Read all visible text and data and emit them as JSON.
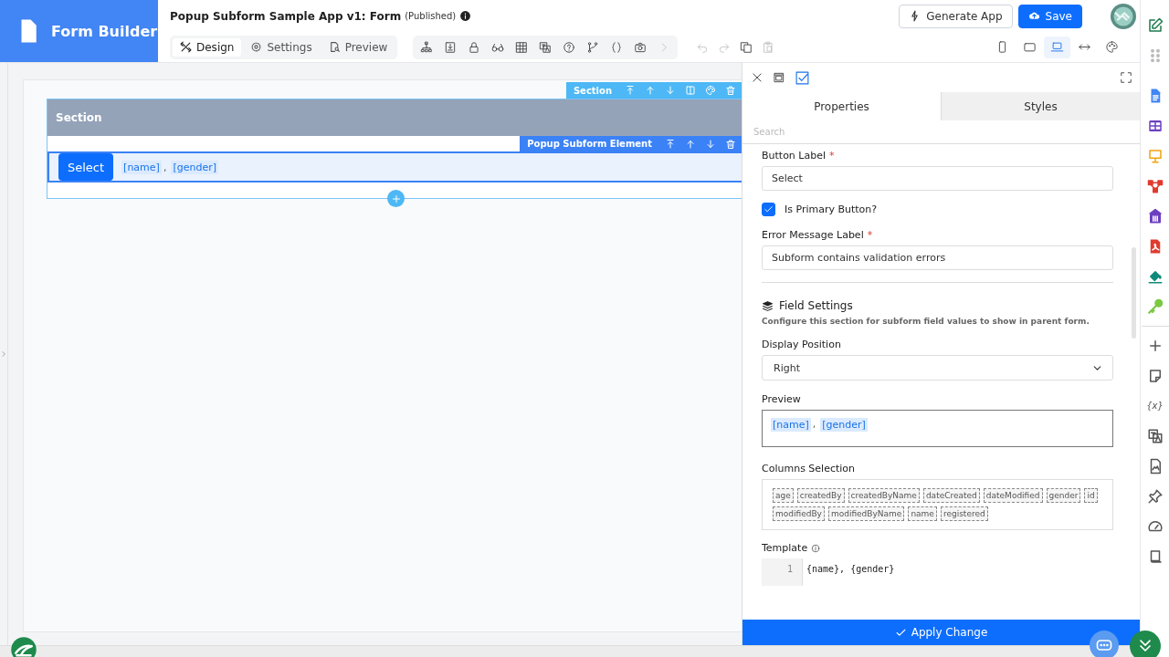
{
  "app": {
    "title": "Form Builder"
  },
  "header": {
    "form_title": "Popup Subform Sample App v1: Form",
    "status": "(Published)"
  },
  "mode_tabs": [
    {
      "label": "Design",
      "kind": "design",
      "selected": true
    },
    {
      "label": "Settings",
      "kind": "settings",
      "selected": false
    },
    {
      "label": "Preview",
      "kind": "preview",
      "selected": false
    }
  ],
  "actions": [
    {
      "label": "Generate App",
      "kind": "secondary"
    },
    {
      "label": "Save",
      "kind": "primary"
    }
  ],
  "devices": [
    {
      "kind": "phone",
      "selected": false
    },
    {
      "kind": "tablet",
      "selected": false
    },
    {
      "kind": "laptop",
      "selected": true
    },
    {
      "kind": "width",
      "selected": false
    },
    {
      "kind": "theme",
      "selected": false
    }
  ],
  "canvas": {
    "section_toolbar": "Section",
    "section_title": "Section",
    "element_toolbar": "Popup Subform Element",
    "button_label": "Select",
    "tokens": [
      "[name]",
      "[gender]"
    ],
    "separator": ","
  },
  "panel": {
    "tabs": [
      {
        "label": "Properties",
        "selected": true
      },
      {
        "label": "Styles",
        "selected": false
      }
    ],
    "search_placeholder": "Search",
    "properties": [
      {
        "kind": "text",
        "label": "Button Label",
        "required": "*",
        "value": "Select"
      },
      {
        "kind": "checkbox",
        "label": "Is Primary Button?",
        "checked": true
      },
      {
        "kind": "text",
        "label": "Error Message Label",
        "required": "*",
        "value": "Subform contains validation errors"
      }
    ],
    "field_settings": {
      "title": "Field Settings",
      "description": "Configure this section for subform field values to show in parent form.",
      "display_position": {
        "label": "Display Position",
        "value": "Right"
      },
      "preview": {
        "label": "Preview",
        "tokens": [
          "[name]",
          "[gender]"
        ],
        "separator": ","
      },
      "columns": {
        "label": "Columns Selection",
        "chips": [
          "age",
          "createdBy",
          "createdByName",
          "dateCreated",
          "dateModified",
          "gender",
          "id",
          "modifiedBy",
          "modifiedByName",
          "name",
          "registered"
        ]
      },
      "template": {
        "label": "Template",
        "line_number": "1",
        "code": "{name}, {gender}"
      }
    },
    "apply_button": "Apply Change"
  },
  "rail_text": "{x}"
}
